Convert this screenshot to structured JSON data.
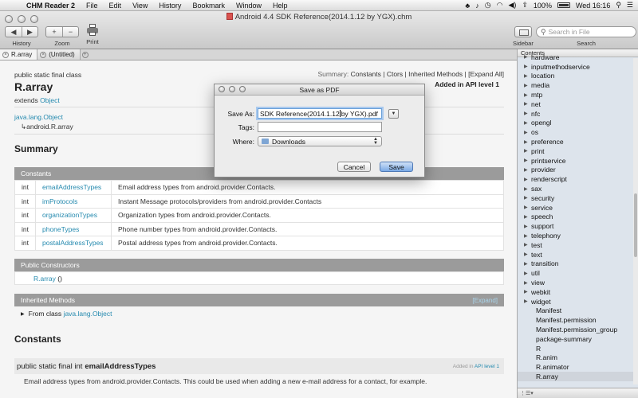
{
  "menubar": {
    "app_name": "CHM Reader 2",
    "menus": [
      "File",
      "Edit",
      "View",
      "History",
      "Bookmark",
      "Window",
      "Help"
    ],
    "battery": "100%",
    "clock": "Wed 16:16"
  },
  "window": {
    "title": "Android 4.4 SDK Reference(2014.1.12 by YGX).chm"
  },
  "toolbar": {
    "history_label": "History",
    "zoom_label": "Zoom",
    "print_label": "Print",
    "sidebar_label": "Sidebar",
    "search_label": "Search",
    "search_placeholder": "Search in File",
    "back_glyph": "◀",
    "forward_glyph": "▶",
    "zoom_in_glyph": "+",
    "zoom_out_glyph": "−"
  },
  "tabs": [
    {
      "label": "R.array"
    },
    {
      "label": "(Untitled)"
    }
  ],
  "page": {
    "class_kind": "public static final class",
    "class_name": "R.array",
    "extends_label": "extends",
    "extends_link": "Object",
    "summary_prefix": "Summary:",
    "summary_links": [
      "Constants",
      "Ctors",
      "Inherited Methods",
      "[Expand All]"
    ],
    "summary_seps": [
      "|",
      "|",
      "|"
    ],
    "api_level": "Added in API level 1",
    "hierarchy_root": "java.lang.Object",
    "hierarchy_child": "android.R.array",
    "hierarchy_arrow": "↳",
    "summary_heading": "Summary",
    "constants_header": "Constants",
    "constants": [
      {
        "type": "int",
        "name": "emailAddressTypes",
        "desc": "Email address types from android.provider.Contacts."
      },
      {
        "type": "int",
        "name": "imProtocols",
        "desc": "Instant Message protocols/providers from android.provider.Contacts"
      },
      {
        "type": "int",
        "name": "organizationTypes",
        "desc": "Organization types from android.provider.Contacts."
      },
      {
        "type": "int",
        "name": "phoneTypes",
        "desc": "Phone number types from android.provider.Contacts."
      },
      {
        "type": "int",
        "name": "postalAddressTypes",
        "desc": "Postal address types from android.provider.Contacts."
      }
    ],
    "ctors_header": "Public Constructors",
    "ctor_name": "R.array",
    "ctor_args": "()",
    "inherited_header": "Inherited Methods",
    "expand_label": "[Expand]",
    "inherited_from_label": "From class",
    "inherited_from_link": "java.lang.Object",
    "constants_heading": "Constants",
    "field_prefix": "public static final int",
    "field_name": "emailAddressTypes",
    "field_added_prefix": "Added in",
    "field_added_link": "API level 1",
    "field_desc": "Email address types from android.provider.Contacts. This could be used when adding a new e-mail address for a contact, for example."
  },
  "sidebar": {
    "header": "Contents",
    "items": [
      {
        "label": "hardware",
        "expandable": true
      },
      {
        "label": "inputmethodservice",
        "expandable": true
      },
      {
        "label": "location",
        "expandable": true
      },
      {
        "label": "media",
        "expandable": true
      },
      {
        "label": "mtp",
        "expandable": true
      },
      {
        "label": "net",
        "expandable": true
      },
      {
        "label": "nfc",
        "expandable": true
      },
      {
        "label": "opengl",
        "expandable": true
      },
      {
        "label": "os",
        "expandable": true
      },
      {
        "label": "preference",
        "expandable": true
      },
      {
        "label": "print",
        "expandable": true
      },
      {
        "label": "printservice",
        "expandable": true
      },
      {
        "label": "provider",
        "expandable": true
      },
      {
        "label": "renderscript",
        "expandable": true
      },
      {
        "label": "sax",
        "expandable": true
      },
      {
        "label": "security",
        "expandable": true
      },
      {
        "label": "service",
        "expandable": true
      },
      {
        "label": "speech",
        "expandable": true
      },
      {
        "label": "support",
        "expandable": true
      },
      {
        "label": "telephony",
        "expandable": true
      },
      {
        "label": "test",
        "expandable": true
      },
      {
        "label": "text",
        "expandable": true
      },
      {
        "label": "transition",
        "expandable": true
      },
      {
        "label": "util",
        "expandable": true
      },
      {
        "label": "view",
        "expandable": true
      },
      {
        "label": "webkit",
        "expandable": true
      },
      {
        "label": "widget",
        "expandable": true
      },
      {
        "label": "Manifest",
        "expandable": false
      },
      {
        "label": "Manifest.permission",
        "expandable": false
      },
      {
        "label": "Manifest.permission_group",
        "expandable": false
      },
      {
        "label": "package-summary",
        "expandable": false
      },
      {
        "label": "R",
        "expandable": false
      },
      {
        "label": "R.anim",
        "expandable": false
      },
      {
        "label": "R.animator",
        "expandable": false
      },
      {
        "label": "R.array",
        "expandable": false,
        "selected": true
      }
    ]
  },
  "dialog": {
    "title": "Save as PDF",
    "save_as_label": "Save As:",
    "save_as_before_caret": "SDK Reference(2014.1.12",
    "save_as_after_caret": " by YGX).pdf",
    "tags_label": "Tags:",
    "tags_value": "",
    "where_label": "Where:",
    "where_value": "Downloads",
    "cancel_label": "Cancel",
    "save_label": "Save"
  }
}
